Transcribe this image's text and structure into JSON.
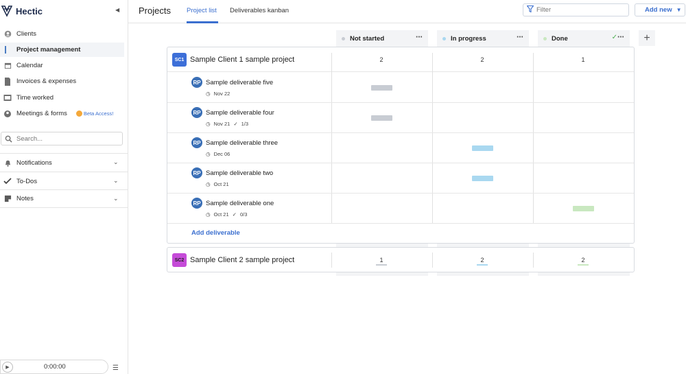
{
  "app": {
    "name": "Hectic"
  },
  "sidebar": {
    "items": [
      {
        "label": "Clients",
        "icon": "user-circle-icon"
      },
      {
        "label": "Project management",
        "icon": "project-icon"
      },
      {
        "label": "Calendar",
        "icon": "calendar-icon"
      },
      {
        "label": "Invoices & expenses",
        "icon": "invoice-icon"
      },
      {
        "label": "Time worked",
        "icon": "clock-icon"
      },
      {
        "label": "Meetings & forms",
        "icon": "meeting-icon"
      }
    ],
    "beta_label": "Beta Access!",
    "search_placeholder": "Search...",
    "sections": [
      {
        "label": "Notifications"
      },
      {
        "label": "To-Dos"
      },
      {
        "label": "Notes"
      }
    ],
    "timer": "0:00:00"
  },
  "header": {
    "title": "Projects",
    "tabs": [
      {
        "label": "Project list"
      },
      {
        "label": "Deliverables kanban"
      }
    ],
    "filter_placeholder": "Filter",
    "add_new": "Add new"
  },
  "columns": [
    {
      "label": "Not started",
      "color": "#c8ccd3"
    },
    {
      "label": "In progress",
      "color": "#a9d8f0"
    },
    {
      "label": "Done",
      "color": "#c9e8c0"
    }
  ],
  "projects": [
    {
      "badge": "SC1",
      "badge_color": "#3d6fd8",
      "name": "Sample Client 1 sample project",
      "counts": [
        "2",
        "2",
        "1"
      ],
      "deliverables": [
        {
          "avatar": "RP",
          "name": "Sample deliverable five",
          "date": "Nov 22",
          "tasks": "",
          "status": 0
        },
        {
          "avatar": "RP",
          "name": "Sample deliverable four",
          "date": "Nov 21",
          "tasks": "1/3",
          "status": 0
        },
        {
          "avatar": "RP",
          "name": "Sample deliverable three",
          "date": "Dec 06",
          "tasks": "",
          "status": 1
        },
        {
          "avatar": "RP",
          "name": "Sample deliverable two",
          "date": "Oct 21",
          "tasks": "",
          "status": 1
        },
        {
          "avatar": "RP",
          "name": "Sample deliverable one",
          "date": "Oct 21",
          "tasks": "0/3",
          "status": 2
        }
      ],
      "add_label": "Add deliverable"
    },
    {
      "badge": "SC2",
      "badge_color": "#c54bd8",
      "name": "Sample Client 2 sample project",
      "counts": [
        "1",
        "2",
        "2"
      ]
    }
  ]
}
